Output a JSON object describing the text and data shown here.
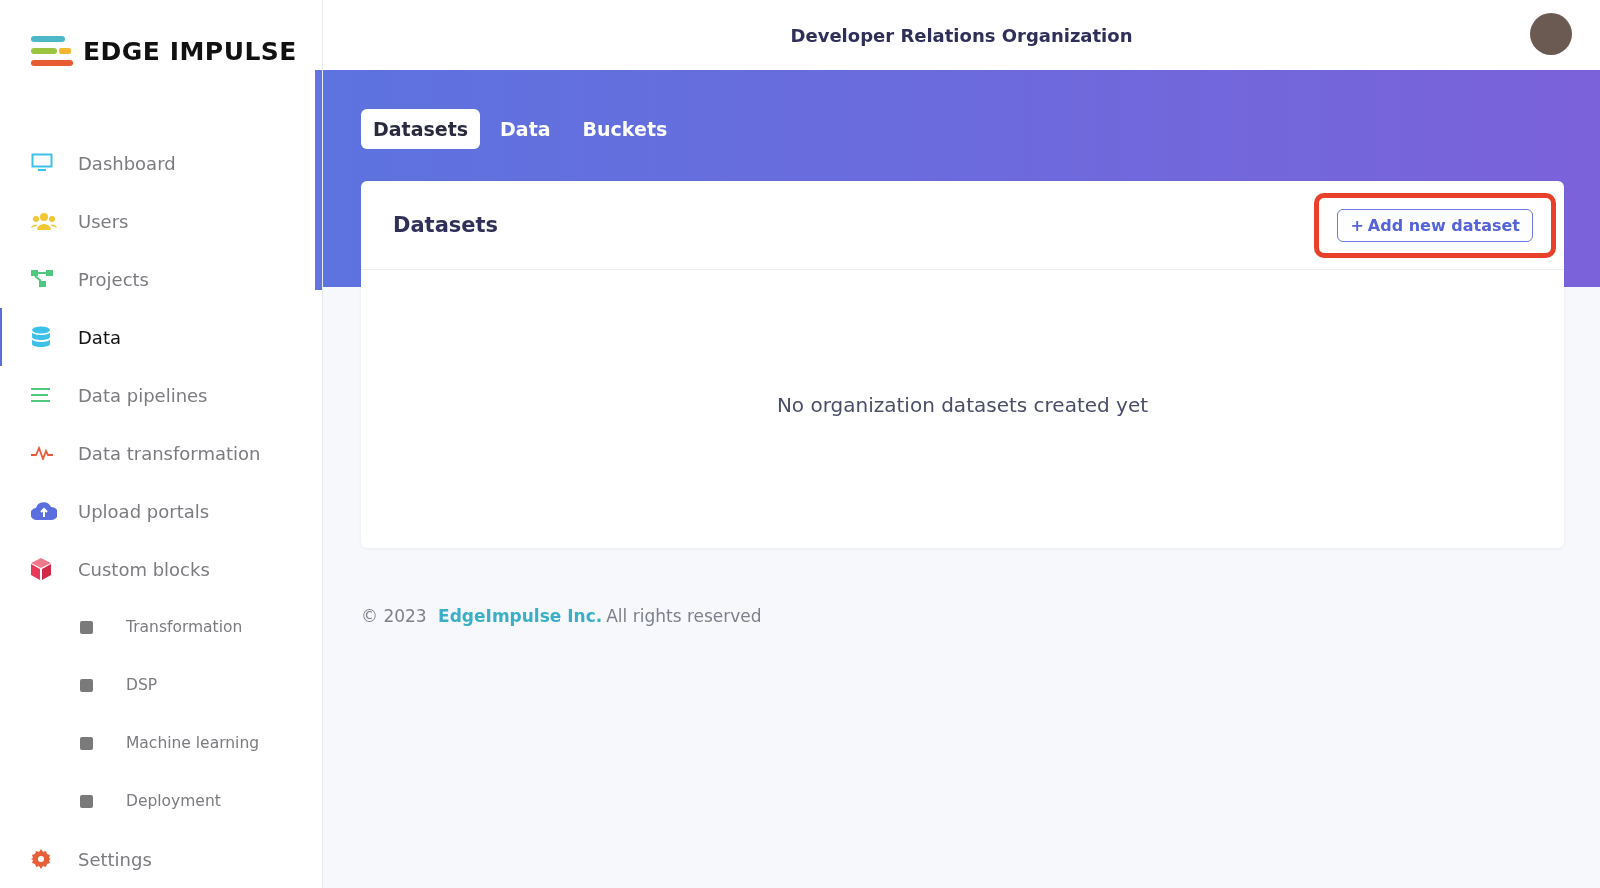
{
  "logo": {
    "text": "EDGE IMPULSE"
  },
  "sidebar": {
    "items": [
      {
        "label": "Dashboard",
        "kind": "item",
        "selected": false
      },
      {
        "label": "Users",
        "kind": "item",
        "selected": false
      },
      {
        "label": "Projects",
        "kind": "item",
        "selected": false
      },
      {
        "label": "Data",
        "kind": "item",
        "selected": true
      },
      {
        "label": "Data pipelines",
        "kind": "item",
        "selected": false
      },
      {
        "label": "Data transformation",
        "kind": "item",
        "selected": false
      },
      {
        "label": "Upload portals",
        "kind": "item",
        "selected": false
      },
      {
        "label": "Custom blocks",
        "kind": "item",
        "selected": false
      },
      {
        "label": "Transformation",
        "kind": "sub",
        "selected": false
      },
      {
        "label": "DSP",
        "kind": "sub",
        "selected": false
      },
      {
        "label": "Machine learning",
        "kind": "sub",
        "selected": false
      },
      {
        "label": "Deployment",
        "kind": "sub",
        "selected": false
      },
      {
        "label": "Settings",
        "kind": "item",
        "selected": false
      }
    ]
  },
  "header": {
    "title": "Developer Relations Organization"
  },
  "tabs": [
    {
      "label": "Datasets",
      "selected": true
    },
    {
      "label": "Data",
      "selected": false
    },
    {
      "label": "Buckets",
      "selected": false
    }
  ],
  "card": {
    "title": "Datasets",
    "button": {
      "label": "Add new dataset",
      "icon": "+",
      "highlighted": true
    },
    "empty_message": "No organization datasets created yet"
  },
  "footer": {
    "copyright": "© 2023",
    "link": "EdgeImpulse Inc.",
    "rest": "All rights reserved"
  }
}
